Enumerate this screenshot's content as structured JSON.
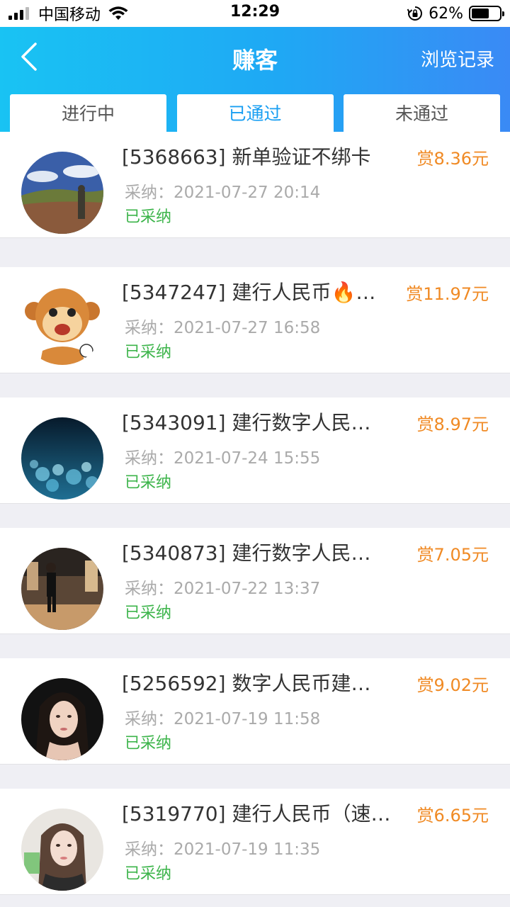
{
  "status_bar": {
    "carrier": "中国移动",
    "time": "12:29",
    "battery": "62%",
    "battery_level": 0.62
  },
  "header": {
    "title": "赚客",
    "history_label": "浏览记录",
    "tabs": [
      {
        "label": "进行中",
        "active": false
      },
      {
        "label": "已通过",
        "active": true
      },
      {
        "label": "未通过",
        "active": false
      }
    ]
  },
  "items": [
    {
      "title": "[5368663] 新单验证不绑卡",
      "time": "采纳：2021-07-27 20:14",
      "status": "已采纳",
      "reward": "赏8.36元",
      "avatar": "landscape-avatar"
    },
    {
      "title": "[5347247] 建行人民币🔥…",
      "time": "采纳：2021-07-27 16:58",
      "status": "已采纳",
      "reward": "赏11.97元",
      "avatar": "monkey-avatar"
    },
    {
      "title": "[5343091] 建行数字人民…",
      "time": "采纳：2021-07-24 15:55",
      "status": "已采纳",
      "reward": "赏8.97元",
      "avatar": "bokeh-avatar"
    },
    {
      "title": "[5340873] 建行数字人民…",
      "time": "采纳：2021-07-22 13:37",
      "status": "已采纳",
      "reward": "赏7.05元",
      "avatar": "person-avatar"
    },
    {
      "title": "[5256592] 数字人民币建…",
      "time": "采纳：2021-07-19 11:58",
      "status": "已采纳",
      "reward": "赏9.02元",
      "avatar": "portrait-avatar"
    },
    {
      "title": "[5319770] 建行人民币（速…",
      "time": "采纳：2021-07-19 11:35",
      "status": "已采纳",
      "reward": "赏6.65元",
      "avatar": "woman-avatar"
    }
  ],
  "colors": {
    "header_start": "#19c3f3",
    "header_end": "#3a8af5",
    "reward": "#f08a24",
    "status_ok": "#3cb44a",
    "tab_active": "#1a9ff2"
  }
}
